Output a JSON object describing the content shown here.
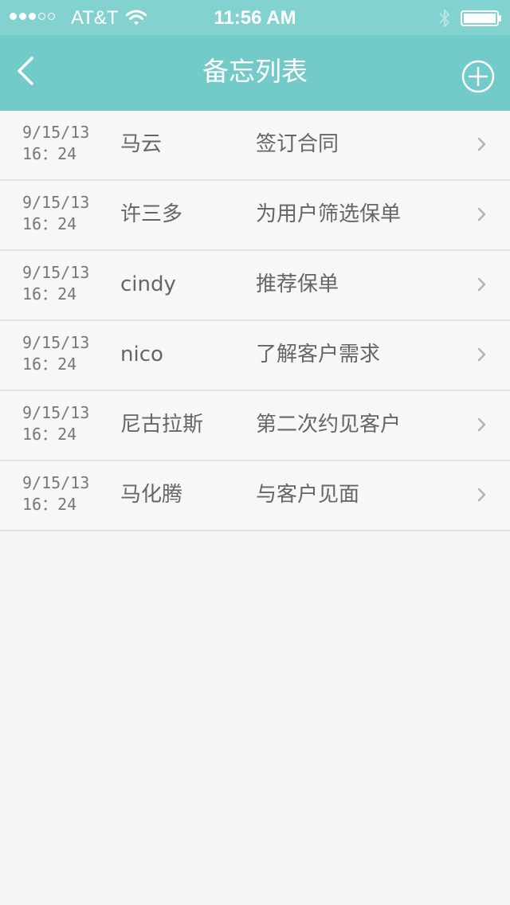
{
  "status_bar": {
    "carrier": "AT&T",
    "time": "11:56 AM",
    "signal_bars_filled": 3,
    "signal_bars_total": 5
  },
  "nav": {
    "title": "备忘列表",
    "back_icon": "chevron-left-icon",
    "add_icon": "plus-circle-icon"
  },
  "colors": {
    "status_bar_bg": "#82d2cf",
    "nav_bg": "#72cbc8",
    "page_bg": "#f5f5f5",
    "text": "#666666",
    "divider": "#e2e2e2"
  },
  "memos": [
    {
      "date": "9/15/13",
      "time": "16：24",
      "name": "马云",
      "task": "签订合同"
    },
    {
      "date": "9/15/13",
      "time": "16：24",
      "name": "许三多",
      "task": "为用户筛选保单"
    },
    {
      "date": "9/15/13",
      "time": "16：24",
      "name": "cindy",
      "task": "推荐保单"
    },
    {
      "date": "9/15/13",
      "time": "16：24",
      "name": "nico",
      "task": "了解客户需求"
    },
    {
      "date": "9/15/13",
      "time": "16：24",
      "name": "尼古拉斯",
      "task": "第二次约见客户"
    },
    {
      "date": "9/15/13",
      "time": "16：24",
      "name": "马化腾",
      "task": "与客户见面"
    }
  ]
}
